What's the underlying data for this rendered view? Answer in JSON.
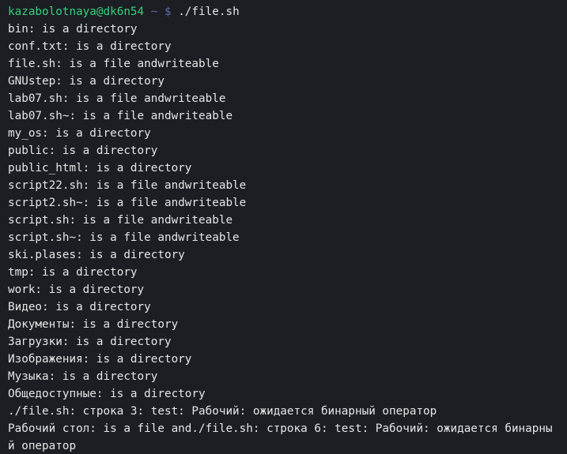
{
  "prompt": {
    "user_host": "kazabolotnaya@dk6n54",
    "cwd": "~",
    "symbol": "$",
    "command": "./file.sh"
  },
  "prev_fragment": "' ^'",
  "output_lines": [
    "bin: is a directory",
    "conf.txt: is a directory",
    "file.sh: is a file andwriteable",
    "GNUstep: is a directory",
    "lab07.sh: is a file andwriteable",
    "lab07.sh~: is a file andwriteable",
    "my_os: is a directory",
    "public: is a directory",
    "public_html: is a directory",
    "script22.sh: is a file andwriteable",
    "script2.sh~: is a file andwriteable",
    "script.sh: is a file andwriteable",
    "script.sh~: is a file andwriteable",
    "ski.plases: is a directory",
    "tmp: is a directory",
    "work: is a directory",
    "Видео: is a directory",
    "Документы: is a directory",
    "Загрузки: is a directory",
    "Изображения: is a directory",
    "Музыка: is a directory",
    "Общедоступные: is a directory",
    "./file.sh: строка 3: test: Рабочий: ожидается бинарный оператор",
    "Рабочий стол: is a file and./file.sh: строка 6: test: Рабочий: ожидается бинарны",
    "й оператор"
  ]
}
